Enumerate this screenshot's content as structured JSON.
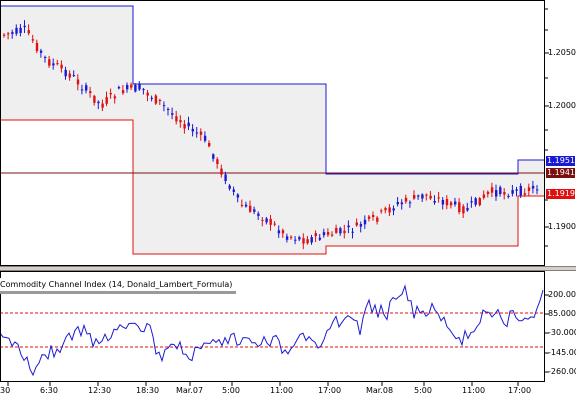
{
  "indicator": {
    "title": "Commodity Channel Index (14, Donald_Lambert_Formula)",
    "levels": [
      "200.00",
      "85.000",
      "-30.000",
      "-145.00",
      "-260.00"
    ]
  },
  "price_axis": {
    "labels": [
      "1.2050",
      "1.2000",
      "1.1900"
    ]
  },
  "price_tags": [
    {
      "value": "1.1951",
      "color": "#1a1ad4"
    },
    {
      "value": "1.1941",
      "color": "#7a1010"
    },
    {
      "value": "1.1919",
      "color": "#e01010"
    }
  ],
  "time_axis": {
    "labels": [
      "30",
      "6:30",
      "12:30",
      "18:30",
      "Mar.07",
      "5:00",
      "11:00",
      "17:00",
      "Mar.08",
      "5:00",
      "11:00",
      "17:00"
    ]
  },
  "colors": {
    "bull": "#1a1ad4",
    "bear": "#e01010",
    "channel_upper": "#1a1ad4",
    "channel_lower": "#e01010",
    "cci_line": "#1a1ad4",
    "cci_levels": "#e01010",
    "shade": "#efefef"
  }
}
